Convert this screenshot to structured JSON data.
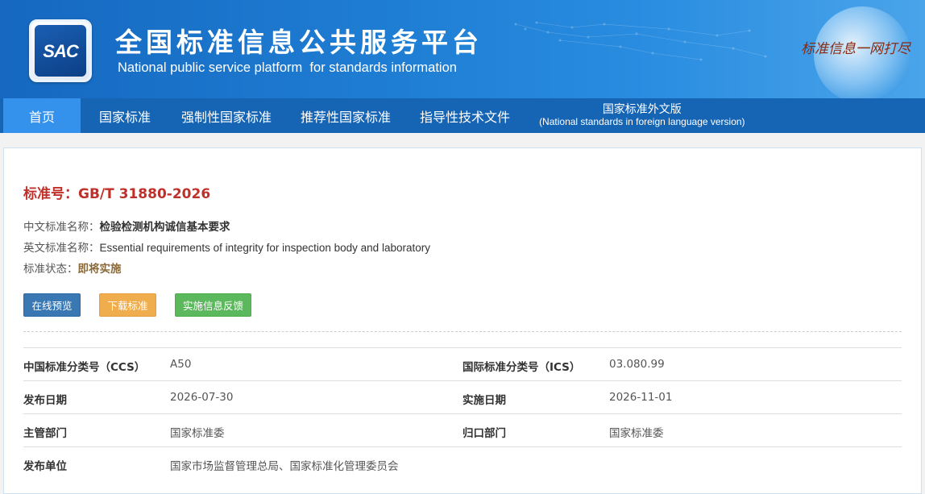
{
  "header": {
    "logo_text": "SAC",
    "title": "全国标准信息公共服务平台",
    "subtitle": "National public service platform  for standards information",
    "slogan": "标准信息一网打尽"
  },
  "nav": {
    "items": [
      {
        "label": "首页",
        "active": true
      },
      {
        "label": "国家标准"
      },
      {
        "label": "强制性国家标准"
      },
      {
        "label": "推荐性国家标准"
      },
      {
        "label": "指导性技术文件"
      }
    ],
    "foreign": {
      "label": "国家标准外文版",
      "sublabel": "(National standards in foreign language version)"
    }
  },
  "standard": {
    "number_label": "标准号：",
    "number": "GB/T 31880-2026",
    "cn_name_label": "中文标准名称：",
    "cn_name": "检验检测机构诚信基本要求",
    "en_name_label": "英文标准名称：",
    "en_name": "Essential requirements of integrity for inspection body and laboratory",
    "status_label": "标准状态：",
    "status": "即将实施"
  },
  "buttons": {
    "preview": "在线预览",
    "download": "下载标准",
    "feedback": "实施信息反馈"
  },
  "meta": {
    "rows": [
      {
        "k1": "中国标准分类号（CCS）",
        "v1": "A50",
        "k2": "国际标准分类号（ICS）",
        "v2": "03.080.99"
      },
      {
        "k1": "发布日期",
        "v1": "2026-07-30",
        "k2": "实施日期",
        "v2": "2026-11-01"
      },
      {
        "k1": "主管部门",
        "v1": "国家标准委",
        "k2": "归口部门",
        "v2": "国家标准委"
      },
      {
        "k1": "发布单位",
        "v1": "国家市场监督管理总局、国家标准化管理委员会",
        "k2": "",
        "v2": ""
      }
    ]
  },
  "colors": {
    "nav_bg": "#1664b4",
    "nav_active": "#3592ec",
    "std_number": "#c0302a",
    "btn_preview": "#3a78b4",
    "btn_download": "#f0ad4e",
    "btn_feedback": "#5cb85c"
  }
}
